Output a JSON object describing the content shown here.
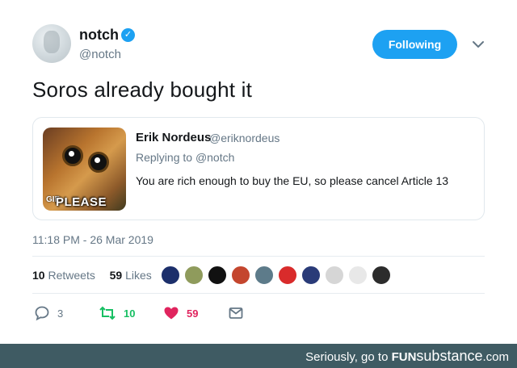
{
  "tweet": {
    "author_name": "notch",
    "author_handle": "@notch",
    "follow_label": "Following",
    "text": "Soros already bought it",
    "timestamp": "11:18 PM - 26 Mar 2019"
  },
  "quote": {
    "author_name": "Erik Nordeus",
    "author_handle": "@eriknordeus",
    "reply_prefix": "Replying to",
    "reply_to": "@notch",
    "text": "You are rich enough to buy the EU, so please cancel Article 13",
    "media_badge": "GIF",
    "media_caption": "PLEASE"
  },
  "stats": {
    "retweets_count": "10",
    "retweets_label": "Retweets",
    "likes_count": "59",
    "likes_label": "Likes",
    "likers": [
      "#1c2f6b",
      "#8f9b5c",
      "#111111",
      "#c4462e",
      "#5d7b8a",
      "#d92b2b",
      "#2a3b78",
      "#d6d6d6",
      "#e8e8e8",
      "#2c2c2c"
    ]
  },
  "actions": {
    "reply_count": "3",
    "retweet_count": "10",
    "like_count": "59"
  },
  "colors": {
    "accent": "#1da1f2",
    "retweet": "#17bf63",
    "like": "#e0245e",
    "muted": "#657786"
  },
  "banner": {
    "prefix": "Seriously, go to",
    "brand_main": "FUN",
    "brand_sub": "substance",
    "brand_tld": ".com"
  }
}
